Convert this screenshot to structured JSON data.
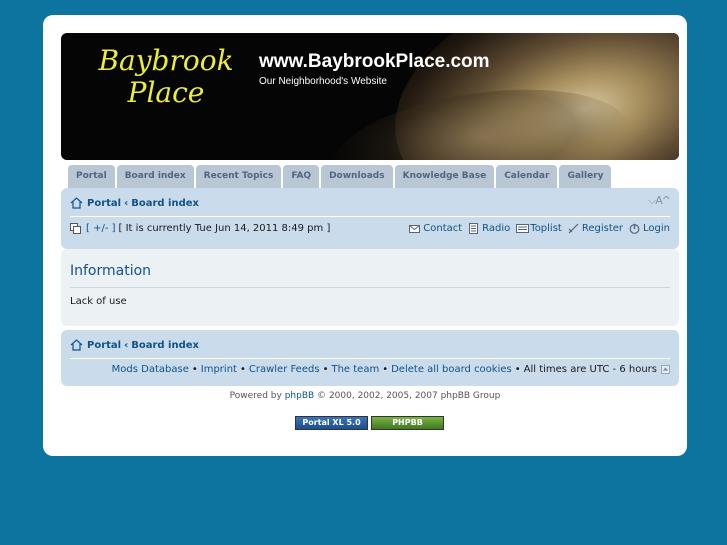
{
  "header": {
    "logo_line1": "Baybrook",
    "logo_line2": "Place",
    "site_title": "www.BaybrookPlace.com",
    "site_description": "Our Neighborhood's Website"
  },
  "tabs": [
    {
      "label": "Portal"
    },
    {
      "label": "Board index"
    },
    {
      "label": "Recent Topics"
    },
    {
      "label": "FAQ"
    },
    {
      "label": "Downloads"
    },
    {
      "label": "Knowledge Base"
    },
    {
      "label": "Calendar"
    },
    {
      "label": "Gallery"
    }
  ],
  "navbar": {
    "crumb_portal": "Portal",
    "crumb_sep": "‹",
    "crumb_board": "Board index",
    "fontsize_label": "⌵A^",
    "toggle": "[ +/- ]",
    "current_time": "[ It is currently Tue Jun 14, 2011 8:49 pm ]",
    "links": {
      "contact": "Contact",
      "radio": "Radio",
      "toplist": "Toplist",
      "register": "Register",
      "login": "Login"
    }
  },
  "content": {
    "heading": "Information",
    "message": "Lack of use"
  },
  "footer": {
    "crumb_portal": "Portal",
    "crumb_sep": "‹",
    "crumb_board": "Board index",
    "links": {
      "mods": "Mods Database",
      "imprint": "Imprint",
      "crawler": "Crawler Feeds",
      "team": "The team",
      "delete_cookies": "Delete all board cookies"
    },
    "bullet": "•",
    "timezone": "All times are UTC - 6 hours",
    "powered_prefix": "Powered by",
    "powered_link": "phpBB",
    "powered_suffix": "© 2000, 2002, 2005, 2007 phpBB Group",
    "badge1": "Portal XL 5.0",
    "badge2": "PHPBB SEO.COM"
  },
  "colors": {
    "background": "#0d74a0",
    "panel": "#cadceb",
    "link": "#105289",
    "logo_text": "#ecec3a"
  }
}
